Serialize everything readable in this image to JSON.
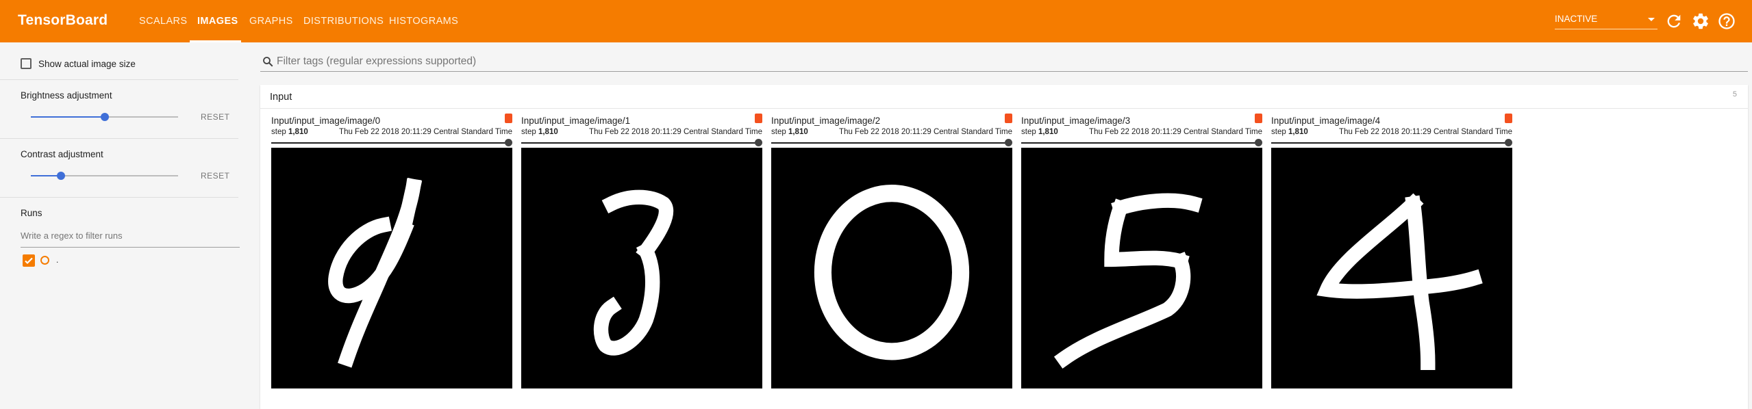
{
  "header": {
    "brand": "TensorBoard",
    "tabs": [
      "SCALARS",
      "IMAGES",
      "GRAPHS",
      "DISTRIBUTIONS",
      "HISTOGRAMS"
    ],
    "active_tab": "IMAGES",
    "run_status": "INACTIVE",
    "icons": [
      "refresh-icon",
      "settings-icon",
      "help-icon"
    ]
  },
  "sidebar": {
    "show_actual_size_label": "Show actual image size",
    "show_actual_size_checked": false,
    "brightness": {
      "label": "Brightness adjustment",
      "reset_label": "RESET",
      "value": 0.5
    },
    "contrast": {
      "label": "Contrast adjustment",
      "reset_label": "RESET",
      "value": 0.2
    },
    "runs": {
      "label": "Runs",
      "filter_placeholder": "Write a regex to filter runs",
      "items": [
        {
          "label": ".",
          "checked": true,
          "color": "#f57c00"
        }
      ]
    }
  },
  "filter": {
    "placeholder": "Filter tags (regular expressions supported)"
  },
  "category": {
    "title": "Input",
    "count": "5",
    "images": [
      {
        "tag": "Input/input_image/image/0",
        "step_label": "step",
        "step": "1,810",
        "timestamp": "Thu Feb 22 2018 20:11:29 Central Standard Time",
        "digit": "9"
      },
      {
        "tag": "Input/input_image/image/1",
        "step_label": "step",
        "step": "1,810",
        "timestamp": "Thu Feb 22 2018 20:11:29 Central Standard Time",
        "digit": "3"
      },
      {
        "tag": "Input/input_image/image/2",
        "step_label": "step",
        "step": "1,810",
        "timestamp": "Thu Feb 22 2018 20:11:29 Central Standard Time",
        "digit": "0"
      },
      {
        "tag": "Input/input_image/image/3",
        "step_label": "step",
        "step": "1,810",
        "timestamp": "Thu Feb 22 2018 20:11:29 Central Standard Time",
        "digit": "5"
      },
      {
        "tag": "Input/input_image/image/4",
        "step_label": "step",
        "step": "1,810",
        "timestamp": "Thu Feb 22 2018 20:11:29 Central Standard Time",
        "digit": "4"
      }
    ]
  },
  "colors": {
    "accent": "#f57c00",
    "slider": "#3f6fd8",
    "sample_button": "#f4511e"
  }
}
